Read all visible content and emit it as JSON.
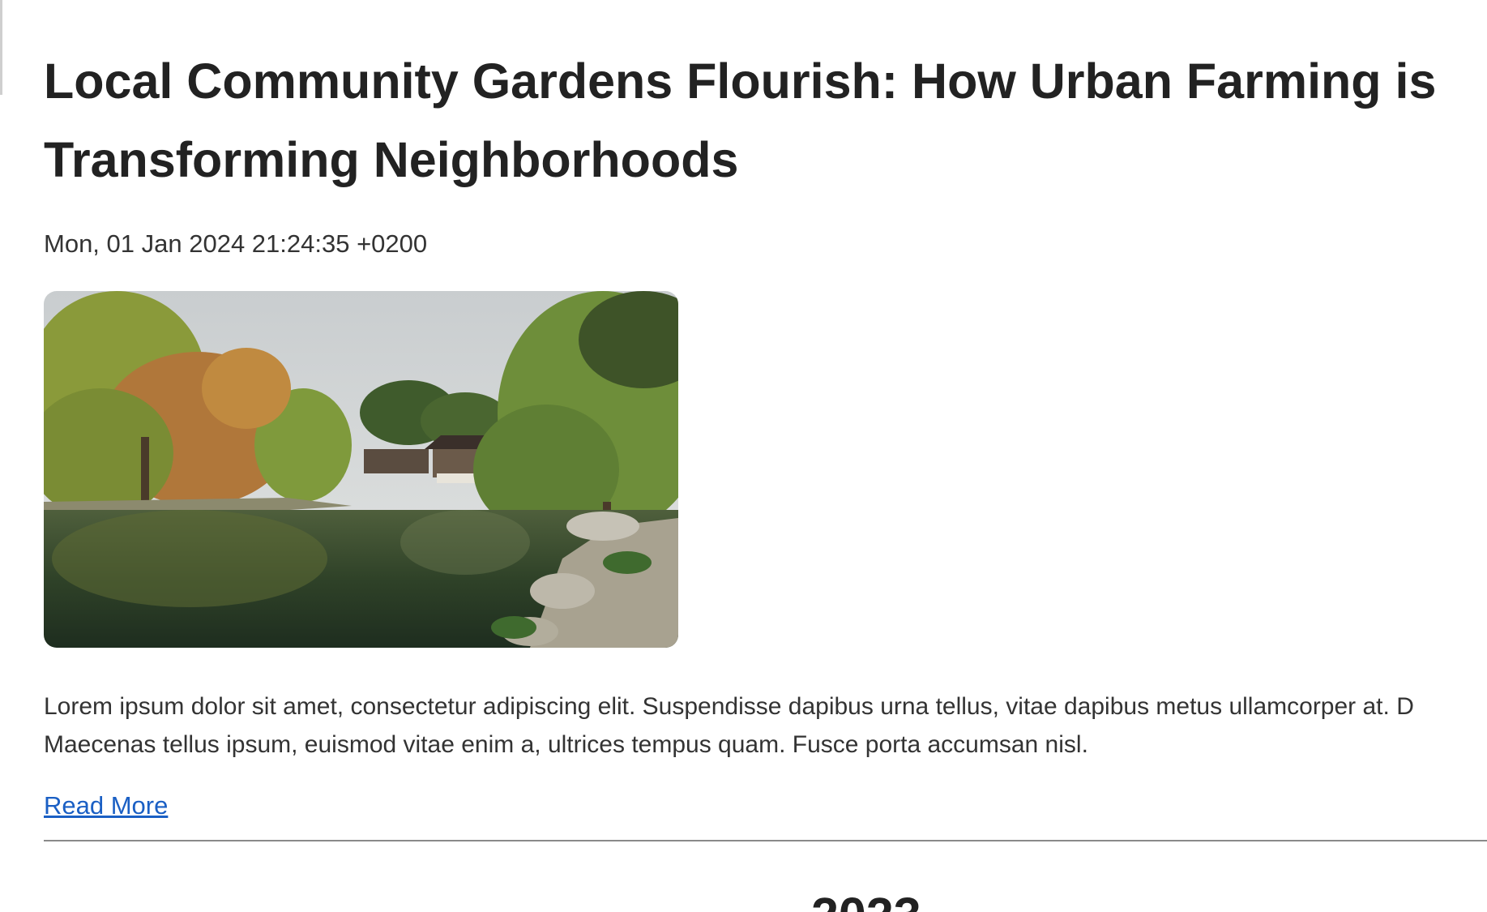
{
  "article": {
    "title_line1": "Local Community Gardens Flourish: How Urban Farming is",
    "title_line2": "Transforming Neighborhoods",
    "date": "Mon, 01 Jan 2024 21:24:35 +0200",
    "image_description": "garden-pond-photo",
    "excerpt_line1": "Lorem ipsum dolor sit amet, consectetur adipiscing elit. Suspendisse dapibus urna tellus, vitae dapibus metus ullamcorper at. D",
    "excerpt_line2": "Maecenas tellus ipsum, euismod vitae enim a, ultrices tempus quam. Fusce porta accumsan nisl.",
    "read_more_label": "Read More"
  },
  "next_article": {
    "title_partial": "2023"
  },
  "colors": {
    "link": "#1a5fc4",
    "text": "#222222",
    "divider": "#8a8a8a"
  }
}
